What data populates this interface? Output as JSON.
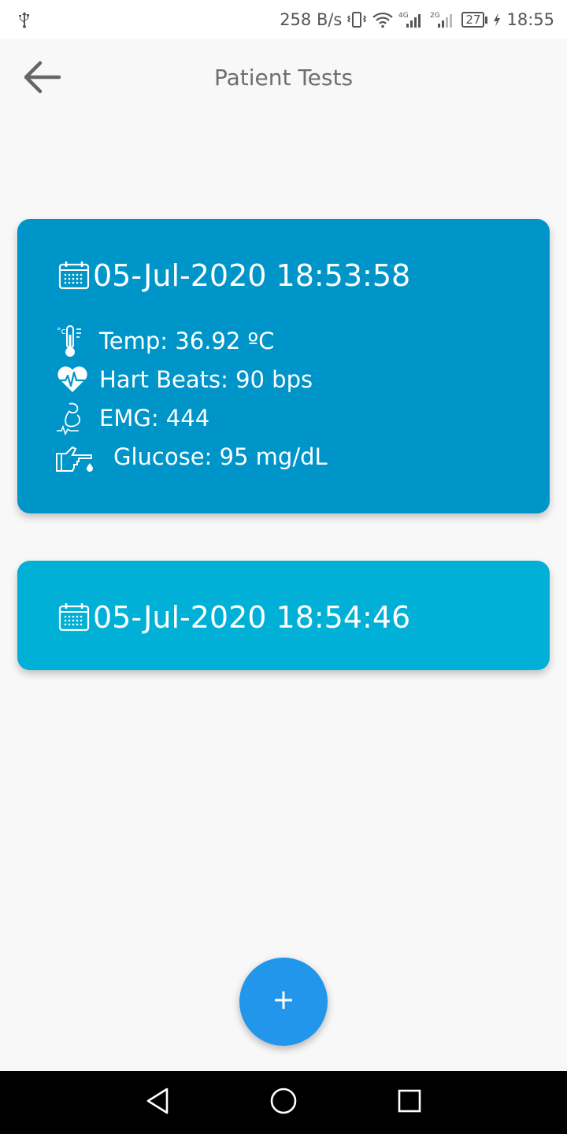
{
  "status_bar": {
    "speed": "258 B/s",
    "battery": "27",
    "time": "18:55",
    "net1": "4G",
    "net2": "2G"
  },
  "header": {
    "title": "Patient Tests"
  },
  "tests": [
    {
      "datetime": "05-Jul-2020 18:53:58",
      "readings": {
        "temp": "Temp: 36.92 ºC",
        "heart": "Hart Beats: 90 bps",
        "emg": "EMG: 444",
        "glucose": "Glucose: 95 mg/dL"
      },
      "color": "#0095c8"
    },
    {
      "datetime": "05-Jul-2020 18:54:46",
      "color": "#00b0d6"
    }
  ],
  "fab": {
    "label": "+"
  },
  "colors": {
    "fab": "#2196ea",
    "card_expanded": "#0095c8",
    "card_collapsed": "#00b0d6"
  },
  "icons": [
    "usb-icon",
    "vibrate-icon",
    "wifi-icon",
    "signal-icon",
    "battery-icon",
    "charging-icon",
    "back-arrow-icon",
    "calendar-icon",
    "thermometer-icon",
    "heartbeat-icon",
    "arm-muscle-icon",
    "glucose-finger-icon",
    "plus-icon",
    "nav-back-icon",
    "nav-home-icon",
    "nav-recents-icon"
  ]
}
